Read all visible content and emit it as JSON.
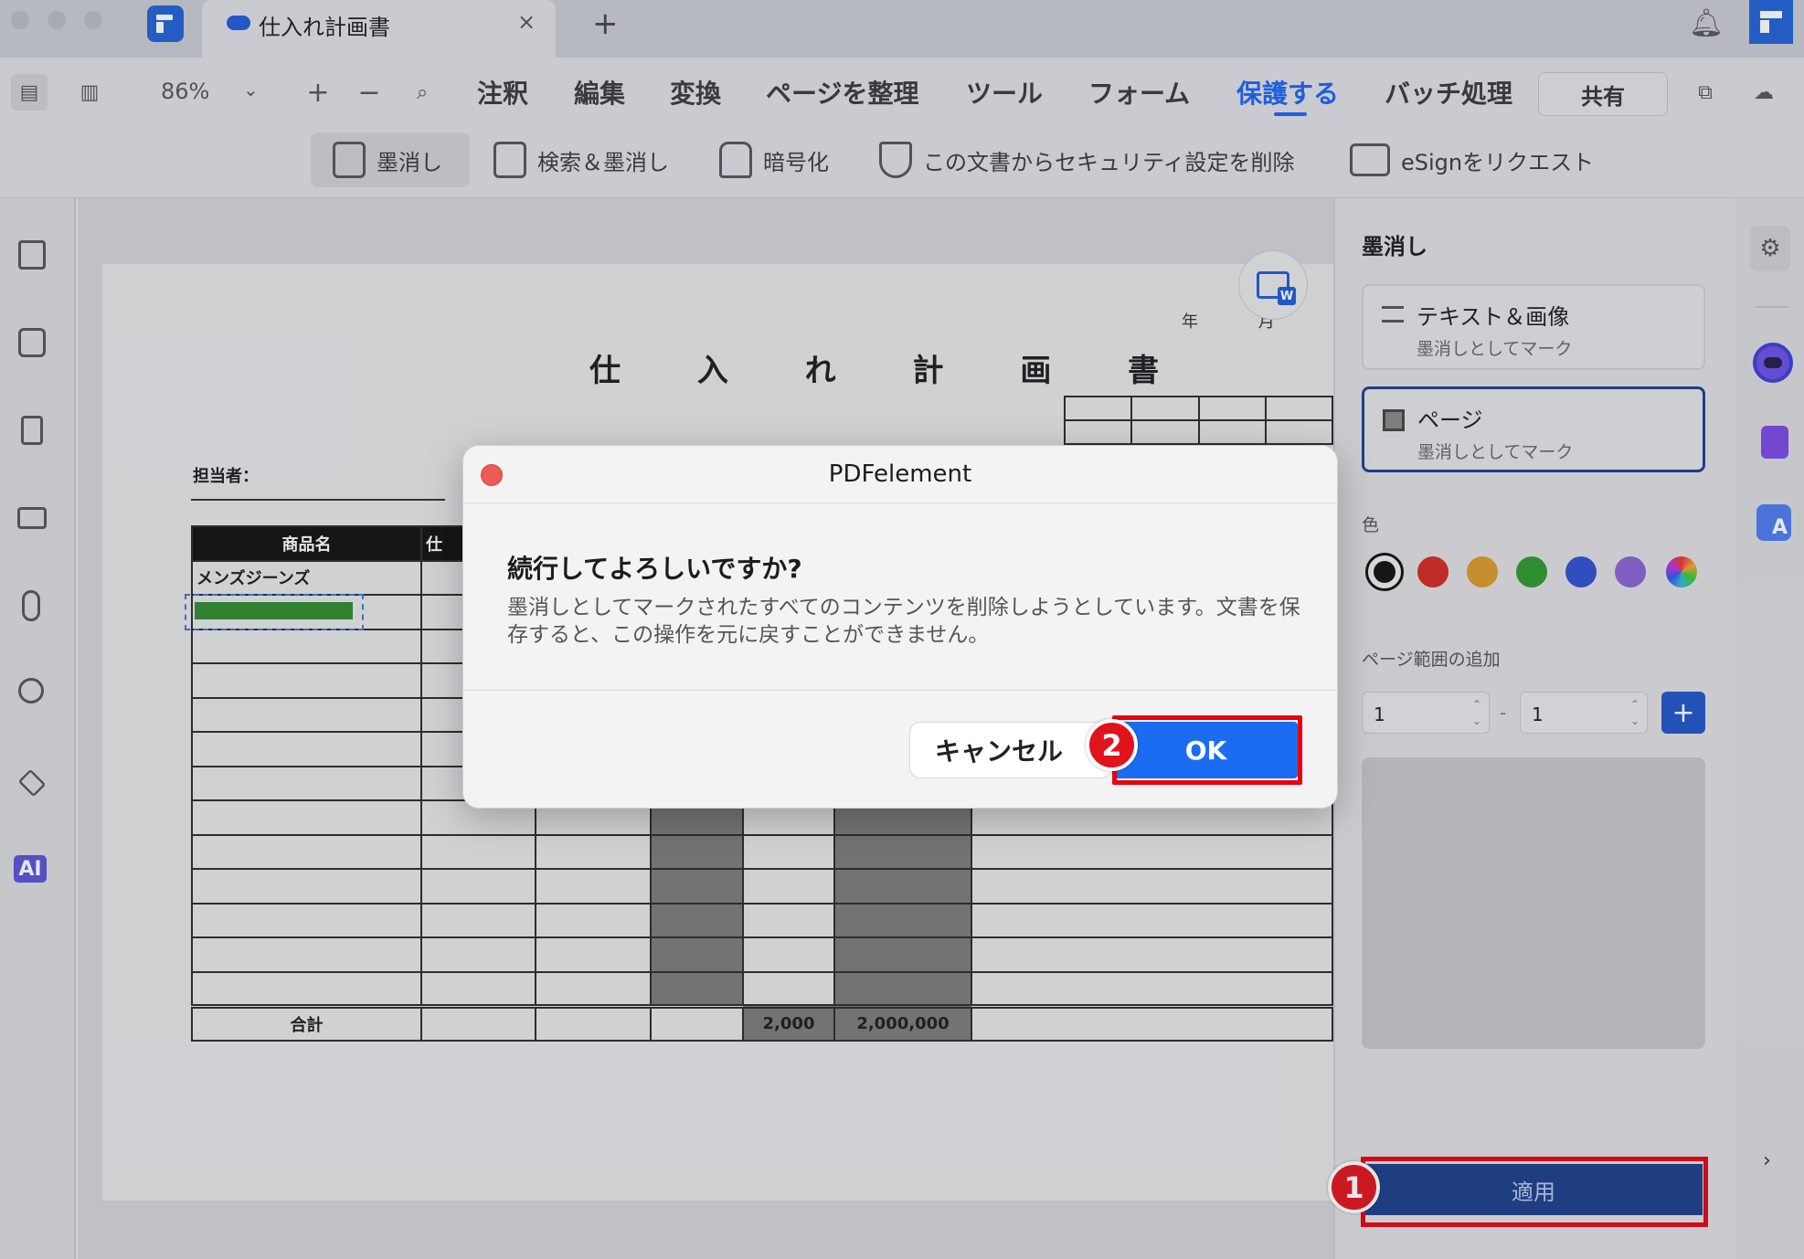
{
  "tab": {
    "title": "仕入れ計画書",
    "close": "×",
    "new": "+"
  },
  "toolbar": {
    "zoom": "86%",
    "zoom_in": "+",
    "zoom_out": "−",
    "menus": [
      "注釈",
      "編集",
      "変換",
      "ページを整理",
      "ツール",
      "フォーム",
      "保護する",
      "バッチ処理"
    ],
    "active_menu": "保護する",
    "share": "共有"
  },
  "subtoolbar": {
    "redact": "墨消し",
    "search_redact": "検索＆墨消し",
    "encrypt": "暗号化",
    "remove_security": "この文書からセキュリティ設定を削除",
    "esign": "eSignをリクエスト"
  },
  "document": {
    "title": "仕 入 れ 計 画 書",
    "date_labels": "年 月 日",
    "person_label": "担当者：",
    "table_header": [
      "商品名",
      "仕"
    ],
    "first_item": "メンズジーンズ",
    "total_label": "合計",
    "total_qty": "2,000",
    "total_amount": "2,000,000"
  },
  "redaction_panel": {
    "title": "墨消し",
    "option_text_image": {
      "label": "テキスト＆画像",
      "sub": "墨消しとしてマーク"
    },
    "option_page": {
      "label": "ページ",
      "sub": "墨消しとしてマーク"
    },
    "color_label": "色",
    "colors": [
      "#111111",
      "#d42a24",
      "#d99a2b",
      "#2e9a2e",
      "#2e51d0",
      "#8a63d4",
      "rainbow"
    ],
    "range_label": "ページ範囲の追加",
    "range_from": "1",
    "range_to": "1",
    "range_sep": "-",
    "add": "+",
    "apply": "適用"
  },
  "dialog": {
    "app": "PDFelement",
    "heading": "続行してよろしいですか?",
    "message": "墨消しとしてマークされたすべてのコンテンツを削除しようとしています。文書を保存すると、この操作を元に戻すことができません。",
    "cancel": "キャンセル",
    "ok": "OK"
  },
  "annotations": {
    "step1": "1",
    "step2": "2"
  },
  "accent_colors": {
    "primary": "#1b6cf0",
    "highlight": "#e8000e"
  }
}
